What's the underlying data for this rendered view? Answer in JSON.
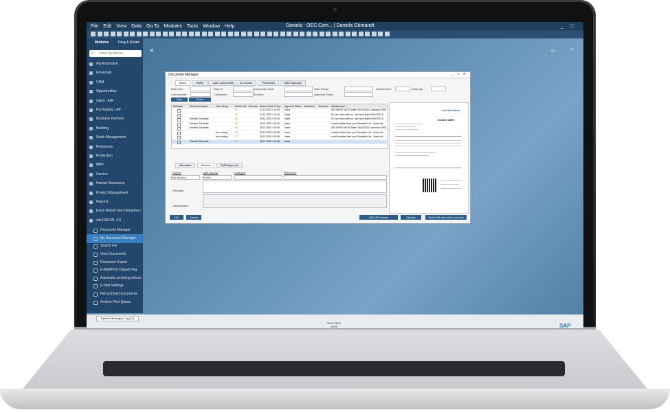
{
  "window": {
    "title": "Daniela - OEC Com... | Daniela Görnandt",
    "controls": "_ □ ✕",
    "menu": [
      "File",
      "Edit",
      "View",
      "Data",
      "Go To",
      "Modules",
      "Tools",
      "Window",
      "Help"
    ]
  },
  "sidebar": {
    "tabs": [
      "Modules",
      "Drag & Relate"
    ],
    "search_placeholder": "Look Up Menus",
    "items": [
      "Administration",
      "Financials",
      "CRM",
      "Opportunities",
      "Sales - A/R",
      "Purchasing - AP",
      "Business Partners",
      "Banking",
      "Stock Management",
      "Resources",
      "Production",
      "MRP",
      "Service",
      "Human Resources",
      "Project Management",
      "Reports",
      "Excel Report and Interactive /",
      "cits DIGITAL 4.0"
    ],
    "subitems": [
      "Document Manager",
      "My Document Manager",
      "Search For",
      "View Documents",
      "Document Export",
      "E-Mail/Print Dispatching",
      "Automatic archiving directo",
      "E-Mail Settings",
      "Not archived documents",
      "Archive Print Queue"
    ],
    "active_subitem": "My Document Manager"
  },
  "doc_manager": {
    "title": "Document Manager",
    "tabs": [
      "Inbox",
      "Drafts",
      "Open Documents",
      "in process",
      "Processed",
      "DMS Approval"
    ],
    "filters": {
      "date_from": "Date from",
      "date_to": "Date to",
      "document_owner": "Document owner",
      "user_group": "User Group",
      "archive_from": "Archive from",
      "authority": "Authority",
      "catchphrase": "Catchphrase",
      "categories": "Categories",
      "archiver": "Archiver",
      "approval_status": "Approval Status"
    },
    "buttons": {
      "filter": "Filter",
      "reset": "Reset"
    },
    "grid": {
      "columns": [
        "Selection",
        "Document owner",
        "User Group",
        "Archive ID",
        "Revision",
        "Archive Date / Time",
        "Approval Status",
        "Authoriser",
        "Remarks",
        "Catchphrase"
      ],
      "rows": [
        {
          "owner": "",
          "group": "",
          "id": "91",
          "date": "24.11.2022 / 10:35",
          "status": "None",
          "phrase": "DELIVERY NOTE Date: 04/11/2022  Lawnmon SHOC"
        },
        {
          "owner": "",
          "group": "",
          "id": "90",
          "date": "24.11.2022 / 10:35",
          "status": "None",
          "phrase": "Do not mess with us - we have learnt  INVOICE A"
        },
        {
          "owner": "Daniela Görnandt",
          "group": "",
          "id": "98",
          "date": "26.11.2022 / 09:15",
          "status": "None",
          "phrase": "Do not mess with us - we have learnt  INVOICE A"
        },
        {
          "owner": "Daniela Görnandt",
          "group": "",
          "id": "95",
          "date": "26.11.2022 / 09:00",
          "status": "None",
          "phrase": "s-sial is better than your  Sweeline Ltd., Canon Ar..."
        },
        {
          "owner": "Daniela Görnandt",
          "group": "",
          "id": "96",
          "date": "26.11.2022 / 09:05",
          "status": "None",
          "phrase": "DELIVERY NOTE Date: 04/11/2022  Lawnmon SHOC"
        },
        {
          "owner": "",
          "group": "Accounting",
          "id": "96",
          "date": "26.11.2022 / 09:05",
          "status": "None",
          "phrase": "s-sial is better than your  Sweeline Ltd., Canon Ar..."
        },
        {
          "owner": "",
          "group": "Accounting",
          "id": "97",
          "date": "26.11.2022 / 09:05",
          "status": "None",
          "phrase": "s-sial is better than your  Sweeline Ltd., Canon Ar..."
        },
        {
          "owner": "Daniela Görnandt",
          "group": "",
          "id": "99",
          "date": "28.11.2022 / 10:08",
          "status": "None",
          "phrase": ""
        }
      ]
    },
    "subtabs": [
      "Allocation",
      "Archive",
      "DMS Approval"
    ],
    "archive_fields": {
      "source": "Source",
      "user_access": "User access",
      "category": "Category",
      "reference": "Reference",
      "source_value": "File archive",
      "access_value": "Public",
      "remarks": "Remarks",
      "catchphrase": "Catchphrase"
    },
    "footer_buttons": {
      "ok": "OK",
      "cancel": "Cancel",
      "center": "ADD AP Invoice",
      "display": "Display",
      "select": "Select file and add to archive"
    },
    "preview": {
      "brand": "cits Solutions",
      "heading": "Invoice 1000"
    }
  },
  "statusbar": {
    "system_messages": "System Messages Log (12)",
    "date": "06.11.2022",
    "time": "10:09",
    "brand": "SAP"
  }
}
